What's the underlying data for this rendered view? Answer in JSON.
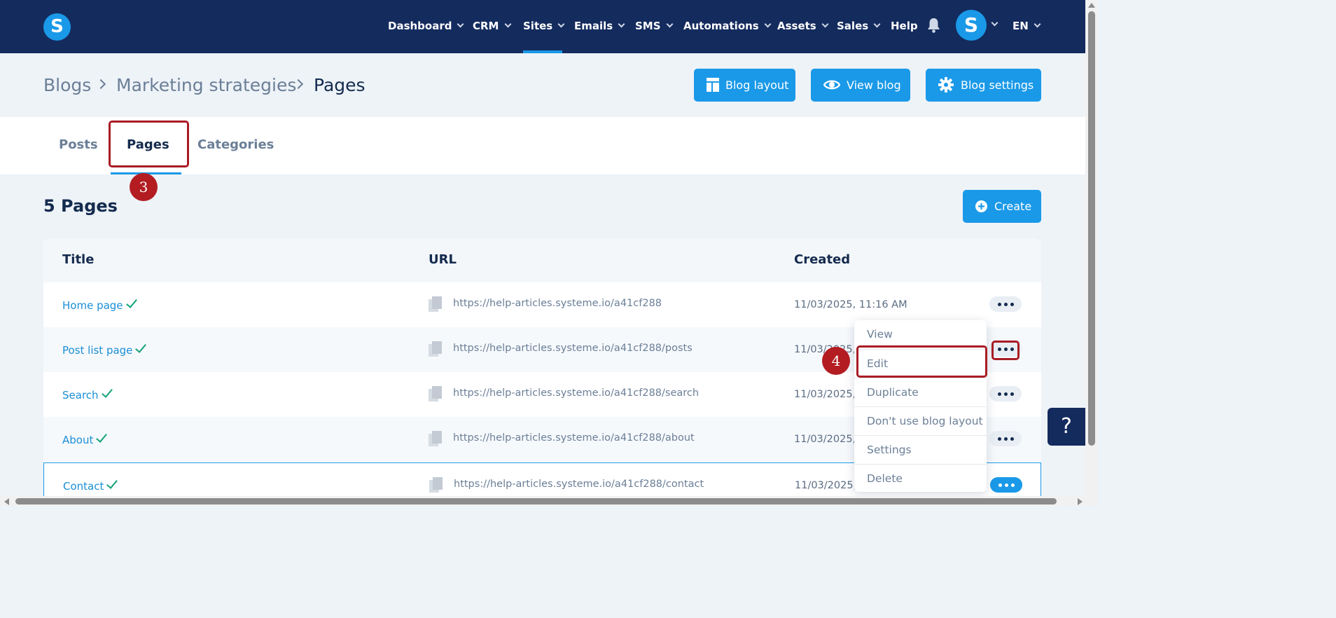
{
  "nav": {
    "logo_letter": "S",
    "items": [
      "Dashboard",
      "CRM",
      "Sites",
      "Emails",
      "SMS",
      "Automations",
      "Assets",
      "Sales",
      "Help"
    ],
    "active": "Sites",
    "avatar_letter": "S",
    "language": "EN",
    "bell_icon": "bell-icon"
  },
  "breadcrumb": {
    "items": [
      "Blogs",
      "Marketing strategies",
      "Pages"
    ]
  },
  "actions": {
    "blog_layout": "Blog layout",
    "view_blog": "View blog",
    "blog_settings": "Blog settings"
  },
  "tabs": {
    "items": [
      "Posts",
      "Pages",
      "Categories"
    ],
    "active": "Pages"
  },
  "annotations": {
    "step3": "3",
    "step4": "4",
    "highlight_color": "#a91c24"
  },
  "list": {
    "count_title": "5 Pages",
    "create_label": "Create",
    "columns": [
      "Title",
      "URL",
      "Created"
    ],
    "rows": [
      {
        "title": "Home page",
        "url": "https://help-articles.systeme.io/a41cf288",
        "created": "11/03/2025, 11:16 AM"
      },
      {
        "title": "Post list page",
        "url": "https://help-articles.systeme.io/a41cf288/posts",
        "created": "11/03/2025, 1"
      },
      {
        "title": "Search",
        "url": "https://help-articles.systeme.io/a41cf288/search",
        "created": "11/03/2025, 1"
      },
      {
        "title": "About",
        "url": "https://help-articles.systeme.io/a41cf288/about",
        "created": "11/03/2025, 1"
      },
      {
        "title": "Contact",
        "url": "https://help-articles.systeme.io/a41cf288/contact",
        "created": "11/03/2025, 1"
      }
    ]
  },
  "menu": {
    "items": [
      "View",
      "Edit",
      "Duplicate",
      "Don't use blog layout",
      "Settings",
      "Delete"
    ]
  },
  "help": {
    "label": "?"
  },
  "colors": {
    "brand": "#142b5e",
    "accent": "#1a99e8",
    "check": "#16a37a"
  }
}
